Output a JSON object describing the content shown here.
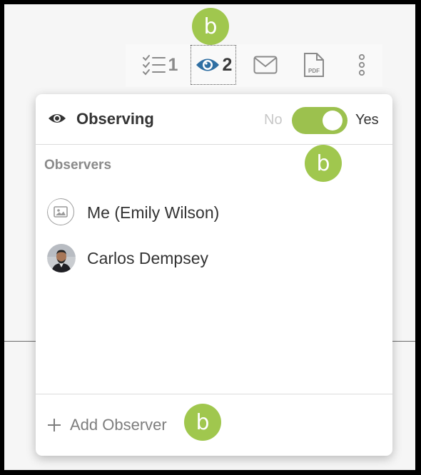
{
  "toolbar": {
    "tasks_count": "1",
    "observers_count": "2",
    "pdf_label": "PDF"
  },
  "badges": {
    "top": "b",
    "toggle": "b",
    "add": "b"
  },
  "popup": {
    "title": "Observing",
    "toggle": {
      "off_label": "No",
      "on_label": "Yes",
      "state": "on"
    },
    "section_label": "Observers",
    "observers": [
      {
        "name": "Me (Emily Wilson)",
        "avatar": "image-placeholder-icon"
      },
      {
        "name": "Carlos Dempsey",
        "avatar": "user-photo"
      }
    ],
    "add_label": "Add Observer"
  },
  "colors": {
    "accent_green": "#a0c74e",
    "eye_blue": "#2f6fa3"
  }
}
